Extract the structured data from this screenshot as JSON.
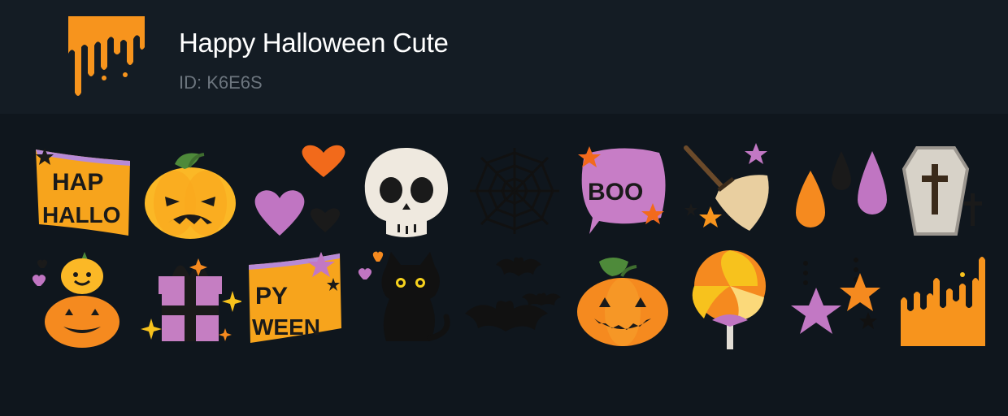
{
  "pack": {
    "title": "Happy Halloween Cute",
    "id_label": "ID: K6E6S",
    "icon": "orange-slime-drip-icon"
  },
  "banner_text": {
    "hap": "HAP",
    "hallo": "HALLO",
    "py": "PY",
    "ween": "WEEN",
    "boo": "BOO"
  },
  "stickers": [
    {
      "name": "hap-hallo-banner-sticker"
    },
    {
      "name": "angry-pumpkin-sticker"
    },
    {
      "name": "hearts-sticker"
    },
    {
      "name": "skull-sticker"
    },
    {
      "name": "spider-web-sticker"
    },
    {
      "name": "boo-ghost-sticker"
    },
    {
      "name": "witch-broom-sticker"
    },
    {
      "name": "drops-sticker"
    },
    {
      "name": "coffin-sticker"
    },
    {
      "name": "stacked-pumpkins-sticker"
    },
    {
      "name": "gift-box-sticker"
    },
    {
      "name": "py-ween-banner-sticker"
    },
    {
      "name": "black-cat-sticker"
    },
    {
      "name": "bats-sticker"
    },
    {
      "name": "jack-o-lantern-sticker"
    },
    {
      "name": "lollipop-sticker"
    },
    {
      "name": "stars-sticker"
    },
    {
      "name": "slime-drip-sticker"
    }
  ],
  "colors": {
    "background": "#0f161d",
    "header": "#141c24",
    "orange": "#f7941d",
    "purple": "#c279c4",
    "title": "#ffffff",
    "id": "#6c757e"
  }
}
